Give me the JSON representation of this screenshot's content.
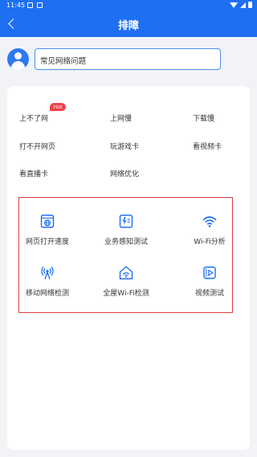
{
  "status_bar": {
    "time": "11:45"
  },
  "nav": {
    "title": "排障"
  },
  "assistant": {
    "message": "常见网络问题"
  },
  "quick_issues": [
    {
      "label": "上不了网",
      "badge": "Hot"
    },
    {
      "label": "上网慢"
    },
    {
      "label": "下载慢"
    },
    {
      "label": "打不开网页"
    },
    {
      "label": "玩游戏卡"
    },
    {
      "label": "看视频卡"
    },
    {
      "label": "看直播卡"
    },
    {
      "label": "网络优化"
    }
  ],
  "tools": [
    {
      "label": "网页打开速度",
      "icon": "browser-globe-icon"
    },
    {
      "label": "业务感知测试",
      "icon": "bolt-speed-icon"
    },
    {
      "label": "Wi-Fi分析",
      "icon": "wifi-icon"
    },
    {
      "label": "移动网络检测",
      "icon": "signal-tower-icon"
    },
    {
      "label": "全屋Wi-Fi检测",
      "icon": "home-wifi-icon"
    },
    {
      "label": "视频测试",
      "icon": "video-play-icon"
    }
  ],
  "colors": {
    "brand": "#1f6ff2",
    "hot": "#f0424c",
    "highlight_border": "#e23c3c"
  }
}
